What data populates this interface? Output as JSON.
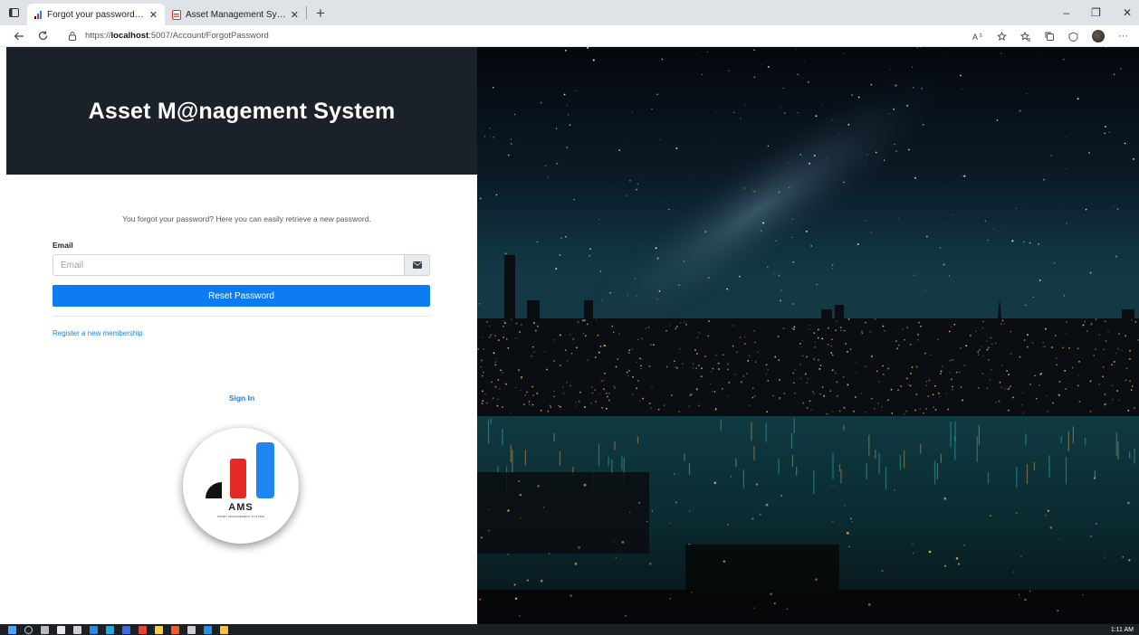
{
  "browser": {
    "tabs": [
      {
        "title": "Forgot your password? - Asset M",
        "close": "✕",
        "active": true
      },
      {
        "title": "Asset Management System.pdf",
        "close": "✕",
        "active": false
      }
    ],
    "new_tab": "+",
    "url_prefix": "https://",
    "url_host": "localhost",
    "url_path": ":5007/Account/ForgotPassword",
    "window_controls": {
      "minimize": "–",
      "restore": "❐",
      "close": "✕"
    },
    "toolbar_more": "···"
  },
  "page": {
    "app_title": "Asset M@nagement System",
    "intro": "You forgot your password? Here you can easily retrieve a new password.",
    "email_label": "Email",
    "email_placeholder": "Email",
    "email_value": "",
    "reset_button": "Reset Password",
    "register_link": "Register a new membership",
    "signin_link": "Sign In",
    "logo_text": "AMS",
    "logo_subtext": "ASSET MANAGEMENT SYSTEM"
  },
  "colors": {
    "header_bg": "#1b2129",
    "accent_blue": "#0d7bf2",
    "logo_red": "#e32a26",
    "logo_blue": "#1d86f2",
    "logo_black": "#111111"
  },
  "taskbar": {
    "clock": "1:11 AM"
  }
}
